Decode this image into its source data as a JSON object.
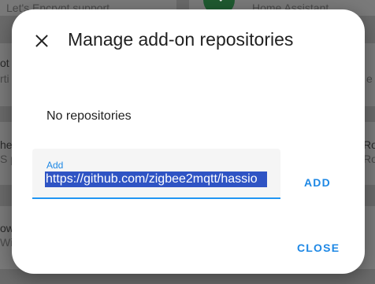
{
  "background": {
    "card_top_left_text": "Let's Encrypt support",
    "card_top_right_text": "Home Assistant",
    "row1_left": "ot",
    "row1_left_sub": "rti",
    "row1_right_sub": "e",
    "row2_left": "he",
    "row2_left_sub": "S p",
    "row2_right": "Ro",
    "row2_right_sub": "Ro",
    "row3_left": "ow",
    "row3_left_sub": "Wi"
  },
  "dialog": {
    "title": "Manage add-on repositories",
    "empty_message": "No repositories",
    "input": {
      "label": "Add",
      "value": "https://github.com/zigbee2mqtt/hassio"
    },
    "add_button": "ADD",
    "close_button": "CLOSE"
  },
  "colors": {
    "accent": "#1e88e5",
    "selection": "#2f54c4"
  }
}
